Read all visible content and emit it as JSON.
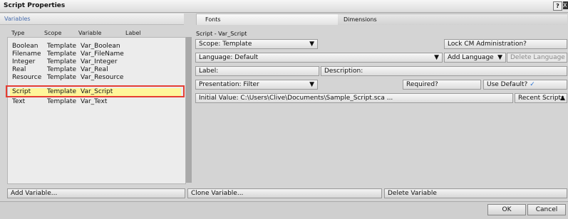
{
  "window": {
    "title": "Script Properties",
    "help": "?",
    "close": "X"
  },
  "tabs": {
    "variables": "Variables",
    "fonts": "Fonts",
    "dimensions": "Dimensions"
  },
  "columns": {
    "type": "Type",
    "scope": "Scope",
    "variable": "Variable",
    "label": "Label"
  },
  "variables": [
    {
      "type": "Boolean",
      "scope": "Template",
      "variable": "Var_Boolean"
    },
    {
      "type": "Filename",
      "scope": "Template",
      "variable": "Var_FileName"
    },
    {
      "type": "Integer",
      "scope": "Template",
      "variable": "Var_Integer"
    },
    {
      "type": "Real",
      "scope": "Template",
      "variable": "Var_Real"
    },
    {
      "type": "Resource",
      "scope": "Template",
      "variable": "Var_Resource"
    },
    {
      "type": "Script",
      "scope": "Template",
      "variable": "Var_Script",
      "selected": true
    },
    {
      "type": "Text",
      "scope": "Template",
      "variable": "Var_Text"
    }
  ],
  "props": {
    "header": "Script - Var_Script",
    "scope": "Scope: Template",
    "lock_cm": "Lock CM Administration?",
    "language": "Language: Default",
    "add_language": "Add Language",
    "delete_language": "Delete Language",
    "label": "Label:",
    "description": "Description:",
    "presentation": "Presentation: Filter",
    "required": "Required?",
    "use_default": "Use Default?",
    "use_default_check": "✓",
    "initial_value": "Initial Value: C:\\Users\\Clive\\Documents\\Sample_Script.sca ...",
    "recent_scripts": "Recent Scripts",
    "dropdown_arrow": "▼",
    "recent_arrow": "▲"
  },
  "buttons": {
    "add_variable": "Add Variable...",
    "clone_variable": "Clone Variable...",
    "delete_variable": "Delete Variable",
    "ok": "OK",
    "cancel": "Cancel"
  },
  "colors": {
    "selection": "#fff69a",
    "highlight_border": "#e53d33",
    "tab_accent": "#4a6fb0",
    "check": "#2b73d4"
  }
}
